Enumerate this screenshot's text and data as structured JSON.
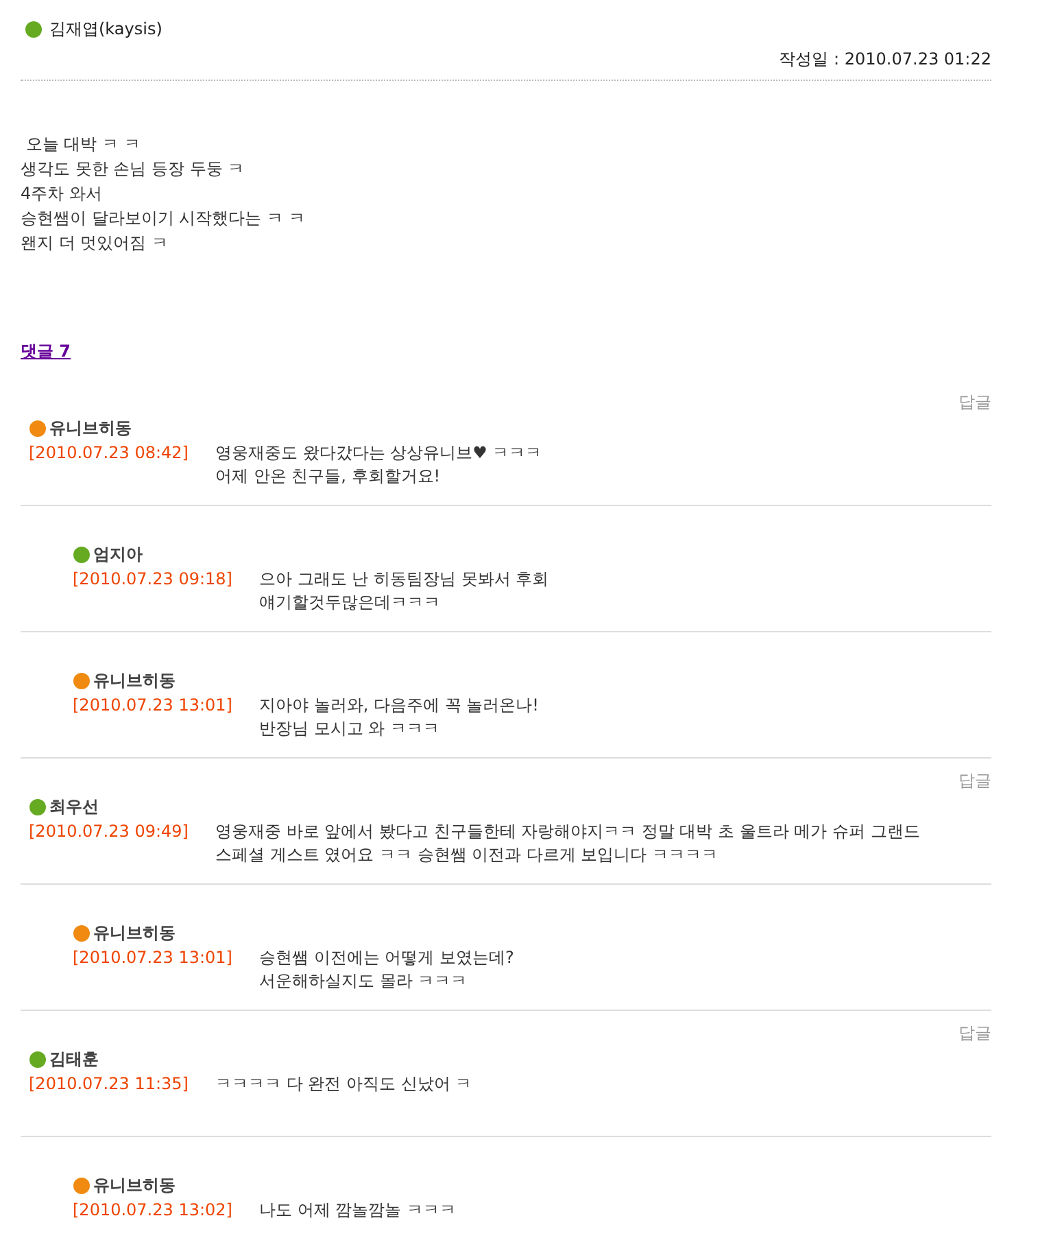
{
  "post": {
    "author": "김재엽(kaysis)",
    "color": "#66aa22",
    "date_label": "작성일 : 2010.07.23 01:22",
    "body": [
      " 오늘 대박 ㅋ ㅋ",
      "생각도 못한 손님 등장 두둥 ㅋ",
      "4주차 와서",
      "승현쌤이 달라보이기 시작했다는 ㅋ ㅋ",
      "왠지 더 멋있어짐 ㅋ"
    ]
  },
  "comments_link": "댓글 7",
  "comments": [
    {
      "reply": "답글",
      "author": "유니브히동",
      "color": "#f08a10",
      "date": "[2010.07.23 08:42]",
      "lines": [
        "영웅재중도 왔다갔다는 상상유니브♥ ㅋㅋㅋ",
        "어제 안온 친구들, 후회할거요!"
      ],
      "children": [
        {
          "author": "엄지아",
          "color": "#66aa22",
          "date": "[2010.07.23 09:18]",
          "lines": [
            "으아 그래도 난 히동팀장님 못봐서 후회",
            "얘기할것두많은데ㅋㅋㅋ"
          ]
        },
        {
          "author": "유니브히동",
          "color": "#f08a10",
          "date": "[2010.07.23 13:01]",
          "lines": [
            "지아야 놀러와, 다음주에 꼭 놀러온나!",
            "반장님 모시고 와 ㅋㅋㅋ"
          ]
        }
      ]
    },
    {
      "reply": "답글",
      "author": "최우선",
      "color": "#66aa22",
      "date": "[2010.07.23 09:49]",
      "lines": [
        "영웅재중 바로 앞에서 봤다고 친구들한테 자랑해야지ㅋㅋ 정말 대박 초 울트라 메가 슈퍼 그랜드",
        "스페셜 게스트 였어요 ㅋㅋ 승현쌤 이전과 다르게 보입니다 ㅋㅋㅋㅋ"
      ],
      "children": [
        {
          "author": "유니브히동",
          "color": "#f08a10",
          "date": "[2010.07.23 13:01]",
          "lines": [
            "승현쌤 이전에는 어떻게 보였는데?",
            "서운해하실지도 몰라 ㅋㅋㅋ"
          ]
        }
      ]
    },
    {
      "reply": "답글",
      "author": "김태훈",
      "color": "#66aa22",
      "date": "[2010.07.23 11:35]",
      "lines": [
        "ㅋㅋㅋㅋ 다 완전 아직도 신났어 ㅋ"
      ],
      "children": [
        {
          "author": "유니브히동",
          "color": "#f08a10",
          "date": "[2010.07.23 13:02]",
          "lines": [
            "나도 어제 깜놀깜놀 ㅋㅋㅋ"
          ]
        }
      ]
    }
  ]
}
